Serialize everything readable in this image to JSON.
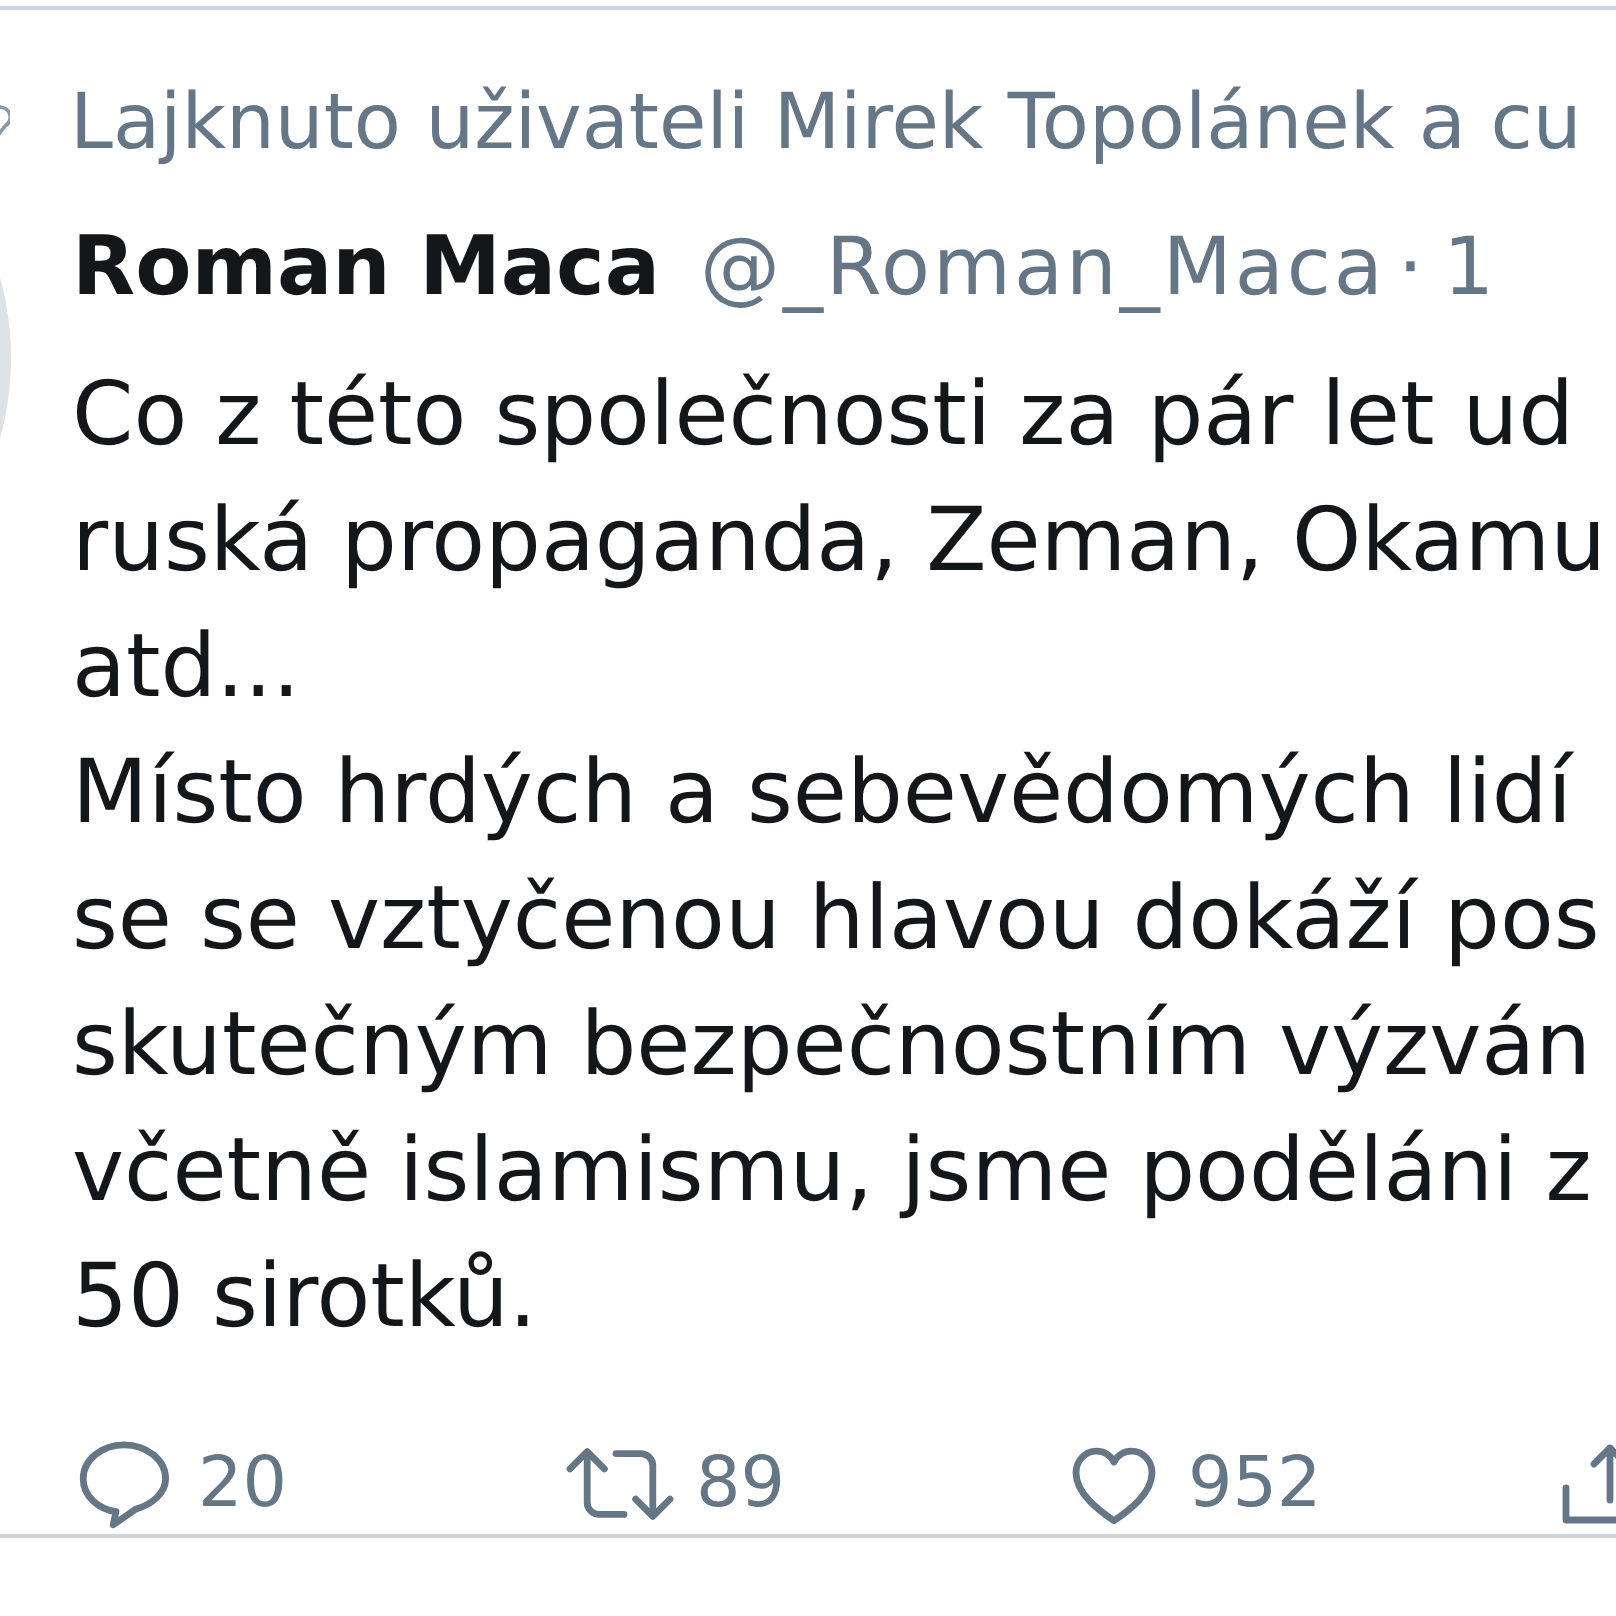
{
  "liked_by": {
    "text": "Lajknuto uživateli Mirek Topolánek a cu"
  },
  "tweet": {
    "author": {
      "name": "Roman Maca",
      "handle": "@_Roman_Maca",
      "separator": "·",
      "time": "1"
    },
    "text_lines": [
      "Co z této společnosti za pár let ud",
      "ruská propaganda, Zeman, Okamu",
      "atd...",
      "Místo hrdých a sebevědomých lidí",
      "se se vztyčenou hlavou dokáží pos",
      "skutečným bezpečnostním výzván",
      "včetně islamismu, jsme poděláni z",
      "50 sirotků."
    ],
    "actions": [
      {
        "kind": "reply",
        "count": "20"
      },
      {
        "kind": "retweet",
        "count": "89"
      },
      {
        "kind": "like",
        "count": "952"
      },
      {
        "kind": "share"
      }
    ]
  }
}
